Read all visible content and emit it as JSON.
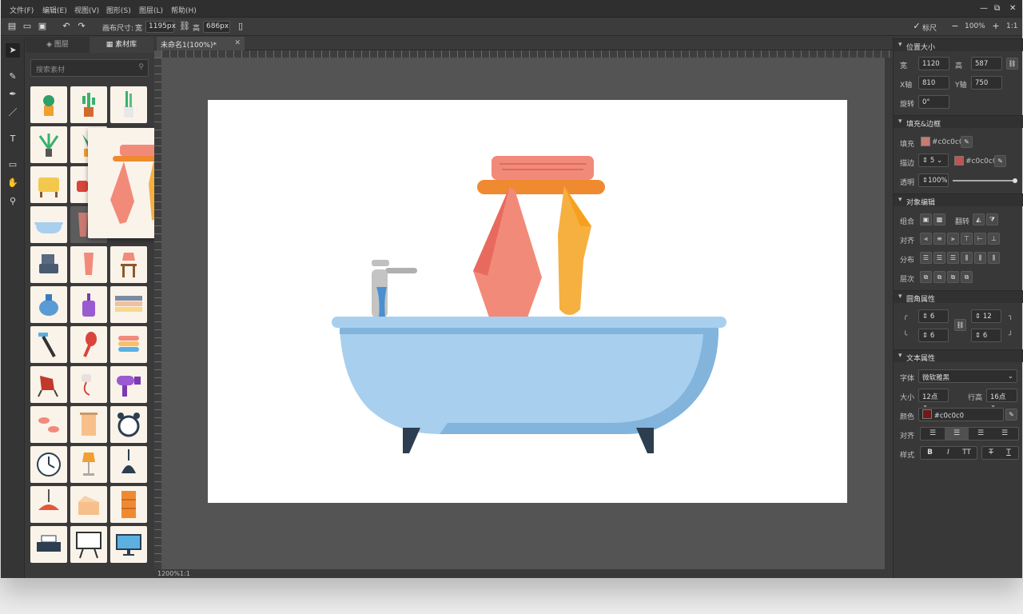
{
  "menu": [
    "文件(F)",
    "编辑(E)",
    "视图(V)",
    "图形(S)",
    "图层(L)",
    "帮助(H)"
  ],
  "window": {
    "minimize": "—",
    "restore": "⧉",
    "close": "✕"
  },
  "toolbar": {
    "canvas_size_label": "画布尺寸:",
    "width_label": "宽",
    "width_value": "1195px",
    "height_label": "高",
    "height_value": "686px",
    "ruler_label": "标尺",
    "zoom": "100%"
  },
  "library": {
    "tab_layers": "图层",
    "tab_library": "素材库",
    "search_placeholder": "搜索素材"
  },
  "document": {
    "tab_title": "未命名1(100%)*",
    "status_zoom": "1200%",
    "status_ratio": "1:1"
  },
  "props": {
    "position_title": "位置大小",
    "w_label": "宽",
    "w_value": "1120",
    "h_label": "高",
    "h_value": "587",
    "x_label": "X轴",
    "x_value": "810",
    "y_label": "Y轴",
    "y_value": "750",
    "rotate_label": "旋转",
    "rotate_value": "0°",
    "fill_title": "填充&边框",
    "fill_label": "填充",
    "fill_color": "#c0c0c0",
    "fill_swatch": "#c97a72",
    "stroke_label": "描边",
    "stroke_width": "5",
    "stroke_color": "#c0c0c0",
    "stroke_swatch": "#c0554f",
    "opacity_label": "透明",
    "opacity_value": "100%",
    "object_title": "对象编辑",
    "group_label": "组合",
    "flip_label": "翻转",
    "align_label": "对齐",
    "distribute_label": "分布",
    "layer_label": "层次",
    "corner_title": "圆角属性",
    "r_tl": "6",
    "r_tr": "12",
    "r_bl": "6",
    "r_br": "6",
    "text_title": "文本属性",
    "font_label": "字体",
    "font_value": "微软雅黑",
    "size_label": "大小",
    "size_value": "12点",
    "line_label": "行高",
    "line_value": "16点",
    "color_label": "颜色",
    "color_value": "#c0c0c0",
    "color_swatch": "#6e1a1a",
    "talign_label": "对齐",
    "style_label": "样式",
    "style_buttons": [
      "B",
      "I",
      "TT"
    ]
  }
}
